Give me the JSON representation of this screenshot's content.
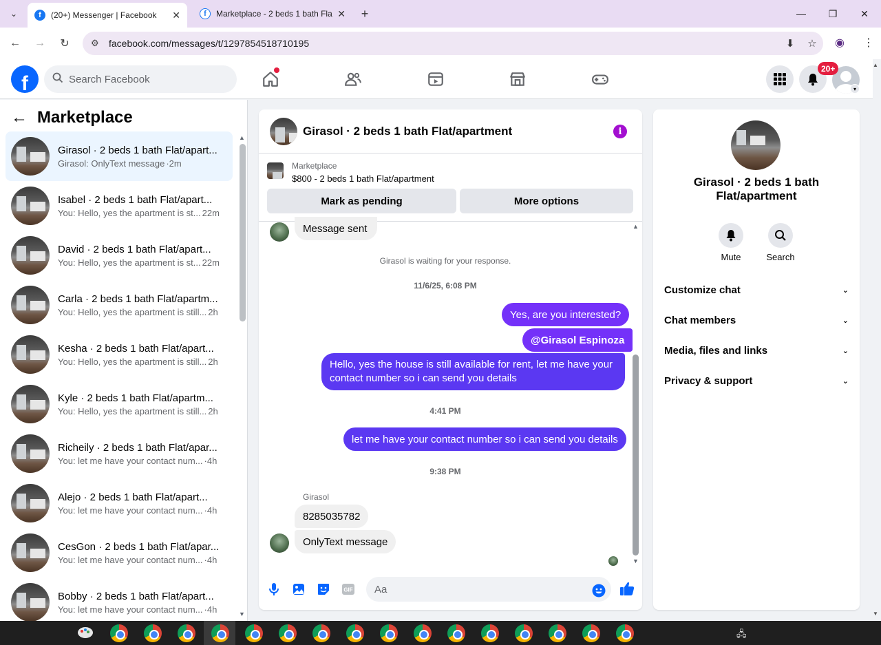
{
  "browser": {
    "tabs": [
      {
        "title": "(20+) Messenger | Facebook",
        "active": true
      },
      {
        "title": "Marketplace - 2 beds 1 bath Fla",
        "active": false
      }
    ],
    "url": "facebook.com/messages/t/1297854518710195"
  },
  "fb_nav": {
    "search_placeholder": "Search Facebook",
    "notification_badge": "20+"
  },
  "left_panel": {
    "title": "Marketplace",
    "conversations": [
      {
        "name": "Girasol · 2 beds 1 bath Flat/apart...",
        "preview": "Girasol: OnlyText message",
        "time": "·2m",
        "active": true
      },
      {
        "name": "Isabel · 2 beds 1 bath Flat/apart...",
        "preview": "You: Hello, yes the apartment is st...",
        "time": "22m",
        "active": false
      },
      {
        "name": "David · 2 beds 1 bath Flat/apart...",
        "preview": "You: Hello, yes the apartment is st...",
        "time": "22m",
        "active": false
      },
      {
        "name": "Carla · 2 beds 1 bath Flat/apartm...",
        "preview": "You: Hello, yes the apartment is still...",
        "time": "2h",
        "active": false
      },
      {
        "name": "Kesha · 2 beds 1 bath Flat/apart...",
        "preview": "You: Hello, yes the apartment is still...",
        "time": "2h",
        "active": false
      },
      {
        "name": "Kyle · 2 beds 1 bath Flat/apartm...",
        "preview": "You: Hello, yes the apartment is still...",
        "time": "2h",
        "active": false
      },
      {
        "name": "Richeily · 2 beds 1 bath Flat/apar...",
        "preview": "You: let me have your contact num...",
        "time": "·4h",
        "active": false
      },
      {
        "name": "Alejo · 2 beds 1 bath Flat/apart...",
        "preview": "You: let me have your contact num...",
        "time": "·4h",
        "active": false
      },
      {
        "name": "CesGon · 2 beds 1 bath Flat/apar...",
        "preview": "You: let me have your contact num...",
        "time": "·4h",
        "active": false
      },
      {
        "name": "Bobby · 2 beds 1 bath Flat/apart...",
        "preview": "You: let me have your contact num...",
        "time": "·4h",
        "active": false
      }
    ]
  },
  "chat": {
    "title": "Girasol · 2 beds 1 bath Flat/apartment",
    "marketplace_label": "Marketplace",
    "listing": "$800 - 2 beds 1 bath Flat/apartment",
    "mark_pending": "Mark as pending",
    "more_options": "More options",
    "messages": {
      "sent_notice": "Message sent",
      "waiting": "Girasol is waiting for your response.",
      "time1": "11/6/25, 6:08 PM",
      "out1": "Yes, are you interested?",
      "out2": "@Girasol Espinoza",
      "out3": "Hello, yes the house is still available for rent, let me have your contact number so i can send you details",
      "time2": "4:41 PM",
      "out4": "let me have your contact number so i can send you details",
      "time3": "9:38 PM",
      "sender": "Girasol",
      "in1": "8285035782",
      "in2": "OnlyText message"
    },
    "composer_placeholder": "Aa"
  },
  "right_panel": {
    "name": "Girasol · 2 beds 1 bath Flat/apartment",
    "mute": "Mute",
    "search": "Search",
    "rows": [
      "Customize chat",
      "Chat members",
      "Media, files and links",
      "Privacy & support"
    ]
  },
  "colors": {
    "fb_blue": "#0866ff",
    "bubble_purple": "#7431f9",
    "bubble_violet": "#5b38f2",
    "info_purple": "#a30fd0",
    "notif_red": "#e41e3f"
  }
}
